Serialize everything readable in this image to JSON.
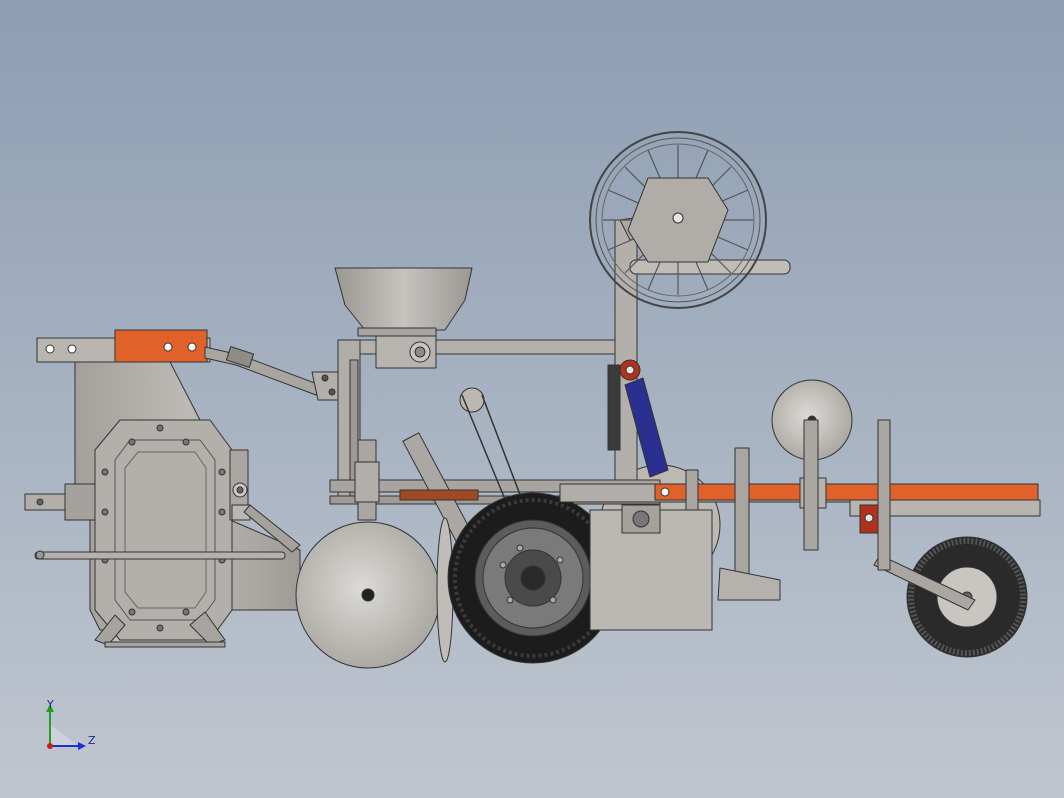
{
  "viewport": {
    "background_top": "#8d9db3",
    "background_bottom": "#c0c6cf"
  },
  "model": {
    "part_color": "#a9a6a1",
    "accent_color": "#e0622a",
    "cylinder_color": "#2b2f8f",
    "bracket_color": "#b0321e",
    "tire_color": "#1c1c1c"
  },
  "triad": {
    "y_label": "Y",
    "z_label": "Z",
    "y_color": "#1fa11f",
    "z_color": "#1a2fd0",
    "x_color": "#d21a1a"
  }
}
